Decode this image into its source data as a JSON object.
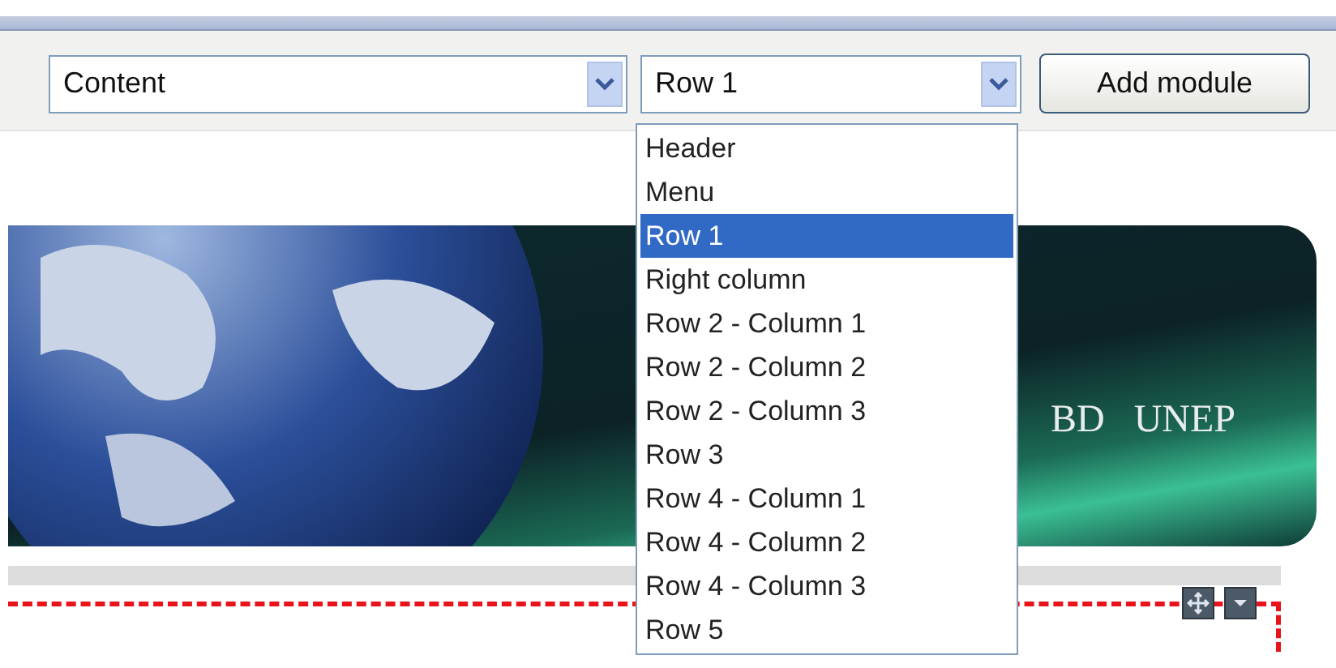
{
  "toolbar": {
    "position_select": {
      "value": "Content"
    },
    "row_select": {
      "value": "Row 1",
      "expanded": true
    },
    "add_button": {
      "label": "Add module"
    }
  },
  "row_options": [
    {
      "label": "Header",
      "selected": false
    },
    {
      "label": "Menu",
      "selected": false
    },
    {
      "label": "Row 1",
      "selected": true
    },
    {
      "label": "Right column",
      "selected": false
    },
    {
      "label": "Row 2 - Column 1",
      "selected": false
    },
    {
      "label": "Row 2 - Column 2",
      "selected": false
    },
    {
      "label": "Row 2 - Column 3",
      "selected": false
    },
    {
      "label": "Row 3",
      "selected": false
    },
    {
      "label": "Row 4 - Column 1",
      "selected": false
    },
    {
      "label": "Row 4 - Column 2",
      "selected": false
    },
    {
      "label": "Row 4 - Column 3",
      "selected": false
    },
    {
      "label": "Row 5",
      "selected": false
    }
  ],
  "banner": {
    "logos": [
      "BD",
      "UNEP"
    ]
  }
}
